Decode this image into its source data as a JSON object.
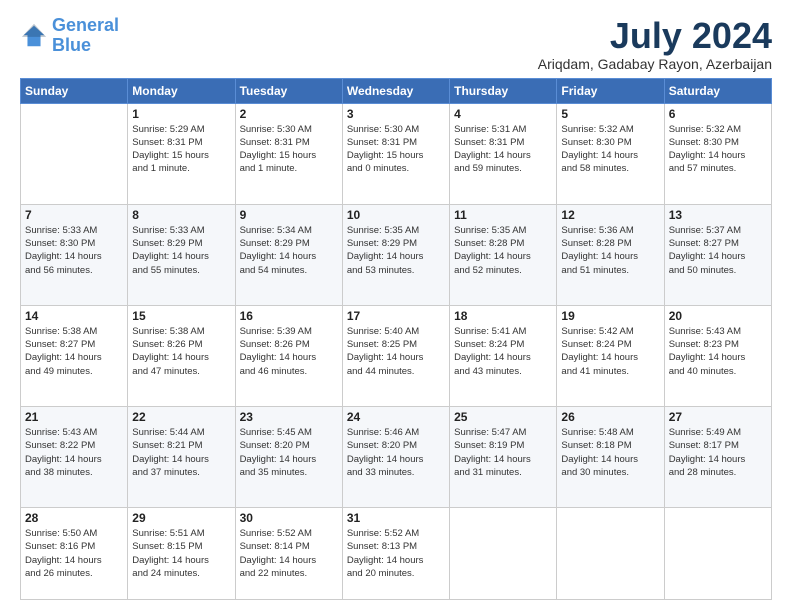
{
  "logo": {
    "line1": "General",
    "line2": "Blue"
  },
  "title": "July 2024",
  "location": "Ariqdam, Gadabay Rayon, Azerbaijan",
  "weekdays": [
    "Sunday",
    "Monday",
    "Tuesday",
    "Wednesday",
    "Thursday",
    "Friday",
    "Saturday"
  ],
  "weeks": [
    [
      {
        "num": "",
        "info": ""
      },
      {
        "num": "1",
        "info": "Sunrise: 5:29 AM\nSunset: 8:31 PM\nDaylight: 15 hours\nand 1 minute."
      },
      {
        "num": "2",
        "info": "Sunrise: 5:30 AM\nSunset: 8:31 PM\nDaylight: 15 hours\nand 1 minute."
      },
      {
        "num": "3",
        "info": "Sunrise: 5:30 AM\nSunset: 8:31 PM\nDaylight: 15 hours\nand 0 minutes."
      },
      {
        "num": "4",
        "info": "Sunrise: 5:31 AM\nSunset: 8:31 PM\nDaylight: 14 hours\nand 59 minutes."
      },
      {
        "num": "5",
        "info": "Sunrise: 5:32 AM\nSunset: 8:30 PM\nDaylight: 14 hours\nand 58 minutes."
      },
      {
        "num": "6",
        "info": "Sunrise: 5:32 AM\nSunset: 8:30 PM\nDaylight: 14 hours\nand 57 minutes."
      }
    ],
    [
      {
        "num": "7",
        "info": "Sunrise: 5:33 AM\nSunset: 8:30 PM\nDaylight: 14 hours\nand 56 minutes."
      },
      {
        "num": "8",
        "info": "Sunrise: 5:33 AM\nSunset: 8:29 PM\nDaylight: 14 hours\nand 55 minutes."
      },
      {
        "num": "9",
        "info": "Sunrise: 5:34 AM\nSunset: 8:29 PM\nDaylight: 14 hours\nand 54 minutes."
      },
      {
        "num": "10",
        "info": "Sunrise: 5:35 AM\nSunset: 8:29 PM\nDaylight: 14 hours\nand 53 minutes."
      },
      {
        "num": "11",
        "info": "Sunrise: 5:35 AM\nSunset: 8:28 PM\nDaylight: 14 hours\nand 52 minutes."
      },
      {
        "num": "12",
        "info": "Sunrise: 5:36 AM\nSunset: 8:28 PM\nDaylight: 14 hours\nand 51 minutes."
      },
      {
        "num": "13",
        "info": "Sunrise: 5:37 AM\nSunset: 8:27 PM\nDaylight: 14 hours\nand 50 minutes."
      }
    ],
    [
      {
        "num": "14",
        "info": "Sunrise: 5:38 AM\nSunset: 8:27 PM\nDaylight: 14 hours\nand 49 minutes."
      },
      {
        "num": "15",
        "info": "Sunrise: 5:38 AM\nSunset: 8:26 PM\nDaylight: 14 hours\nand 47 minutes."
      },
      {
        "num": "16",
        "info": "Sunrise: 5:39 AM\nSunset: 8:26 PM\nDaylight: 14 hours\nand 46 minutes."
      },
      {
        "num": "17",
        "info": "Sunrise: 5:40 AM\nSunset: 8:25 PM\nDaylight: 14 hours\nand 44 minutes."
      },
      {
        "num": "18",
        "info": "Sunrise: 5:41 AM\nSunset: 8:24 PM\nDaylight: 14 hours\nand 43 minutes."
      },
      {
        "num": "19",
        "info": "Sunrise: 5:42 AM\nSunset: 8:24 PM\nDaylight: 14 hours\nand 41 minutes."
      },
      {
        "num": "20",
        "info": "Sunrise: 5:43 AM\nSunset: 8:23 PM\nDaylight: 14 hours\nand 40 minutes."
      }
    ],
    [
      {
        "num": "21",
        "info": "Sunrise: 5:43 AM\nSunset: 8:22 PM\nDaylight: 14 hours\nand 38 minutes."
      },
      {
        "num": "22",
        "info": "Sunrise: 5:44 AM\nSunset: 8:21 PM\nDaylight: 14 hours\nand 37 minutes."
      },
      {
        "num": "23",
        "info": "Sunrise: 5:45 AM\nSunset: 8:20 PM\nDaylight: 14 hours\nand 35 minutes."
      },
      {
        "num": "24",
        "info": "Sunrise: 5:46 AM\nSunset: 8:20 PM\nDaylight: 14 hours\nand 33 minutes."
      },
      {
        "num": "25",
        "info": "Sunrise: 5:47 AM\nSunset: 8:19 PM\nDaylight: 14 hours\nand 31 minutes."
      },
      {
        "num": "26",
        "info": "Sunrise: 5:48 AM\nSunset: 8:18 PM\nDaylight: 14 hours\nand 30 minutes."
      },
      {
        "num": "27",
        "info": "Sunrise: 5:49 AM\nSunset: 8:17 PM\nDaylight: 14 hours\nand 28 minutes."
      }
    ],
    [
      {
        "num": "28",
        "info": "Sunrise: 5:50 AM\nSunset: 8:16 PM\nDaylight: 14 hours\nand 26 minutes."
      },
      {
        "num": "29",
        "info": "Sunrise: 5:51 AM\nSunset: 8:15 PM\nDaylight: 14 hours\nand 24 minutes."
      },
      {
        "num": "30",
        "info": "Sunrise: 5:52 AM\nSunset: 8:14 PM\nDaylight: 14 hours\nand 22 minutes."
      },
      {
        "num": "31",
        "info": "Sunrise: 5:52 AM\nSunset: 8:13 PM\nDaylight: 14 hours\nand 20 minutes."
      },
      {
        "num": "",
        "info": ""
      },
      {
        "num": "",
        "info": ""
      },
      {
        "num": "",
        "info": ""
      }
    ]
  ]
}
